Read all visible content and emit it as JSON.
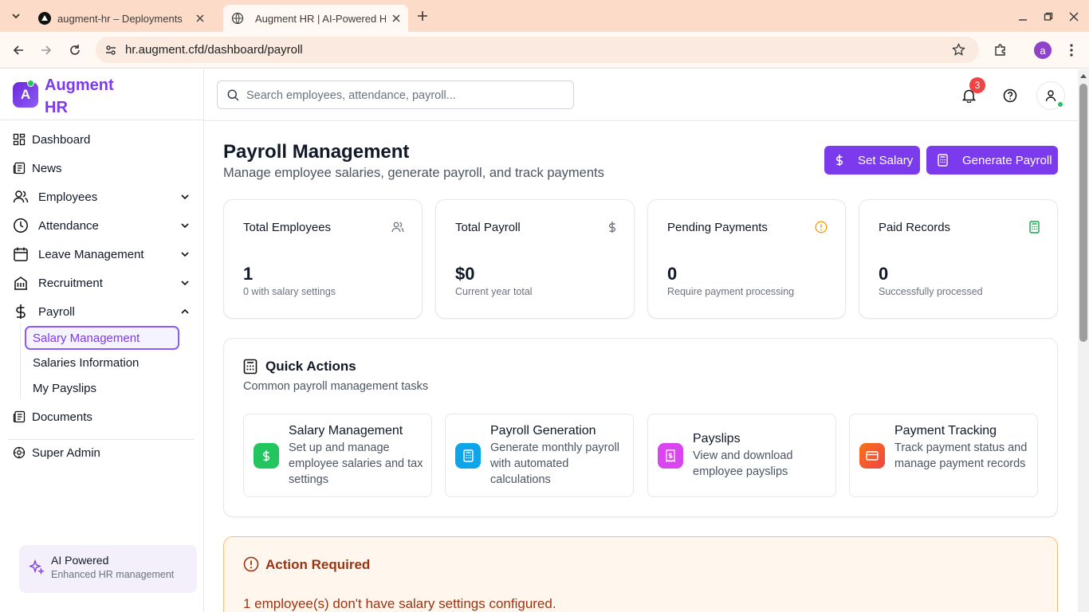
{
  "browser": {
    "tabs": [
      {
        "title": "augment-hr – Deployments"
      },
      {
        "title": "Augment HR | AI-Powered HR"
      }
    ],
    "url": "hr.augment.cfd/dashboard/payroll",
    "profile_initial": "a"
  },
  "brand": {
    "initial": "A",
    "line1": "Augment",
    "line2": "HR"
  },
  "sidebar": {
    "items": [
      {
        "label": "Dashboard"
      },
      {
        "label": "News"
      },
      {
        "label": "Employees"
      },
      {
        "label": "Attendance"
      },
      {
        "label": "Leave Management"
      },
      {
        "label": "Recruitment"
      },
      {
        "label": "Payroll"
      }
    ],
    "payroll_sub": [
      {
        "label": "Salary Management"
      },
      {
        "label": "Salaries Information"
      },
      {
        "label": "My Payslips"
      }
    ],
    "documents": "Documents",
    "super_admin": "Super Admin",
    "ai": {
      "title": "AI Powered",
      "subtitle": "Enhanced HR management"
    }
  },
  "topbar": {
    "search_placeholder": "Search employees, attendance, payroll...",
    "notification_count": "3"
  },
  "page": {
    "title": "Payroll Management",
    "subtitle": "Manage employee salaries, generate payroll, and track payments",
    "set_salary": "Set Salary",
    "generate_payroll": "Generate Payroll"
  },
  "stats": [
    {
      "title": "Total Employees",
      "value": "1",
      "sub": "0 with salary settings"
    },
    {
      "title": "Total Payroll",
      "value": "$0",
      "sub": "Current year total"
    },
    {
      "title": "Pending Payments",
      "value": "0",
      "sub": "Require payment processing"
    },
    {
      "title": "Paid Records",
      "value": "0",
      "sub": "Successfully processed"
    }
  ],
  "quick_actions": {
    "title": "Quick Actions",
    "subtitle": "Common payroll management tasks",
    "items": [
      {
        "title": "Salary Management",
        "desc": "Set up and manage employee salaries and tax settings",
        "icon": "dollar-icon",
        "color": "#22c55e"
      },
      {
        "title": "Payroll Generation",
        "desc": "Generate monthly payroll with automated calculations",
        "icon": "calculator-icon",
        "color": "#0ea5e9"
      },
      {
        "title": "Payslips",
        "desc": "View and download employee payslips",
        "icon": "receipt-icon",
        "color": "#d946ef"
      },
      {
        "title": "Payment Tracking",
        "desc": "Track payment status and manage payment records",
        "icon": "credit-card-icon",
        "color": "#f97316"
      }
    ]
  },
  "alert": {
    "title": "Action Required",
    "message": "1 employee(s) don't have salary settings configured."
  },
  "colors": {
    "accent": "#7c3aed",
    "alert_text": "#9a3412",
    "alert_bg": "#fff7ed"
  }
}
